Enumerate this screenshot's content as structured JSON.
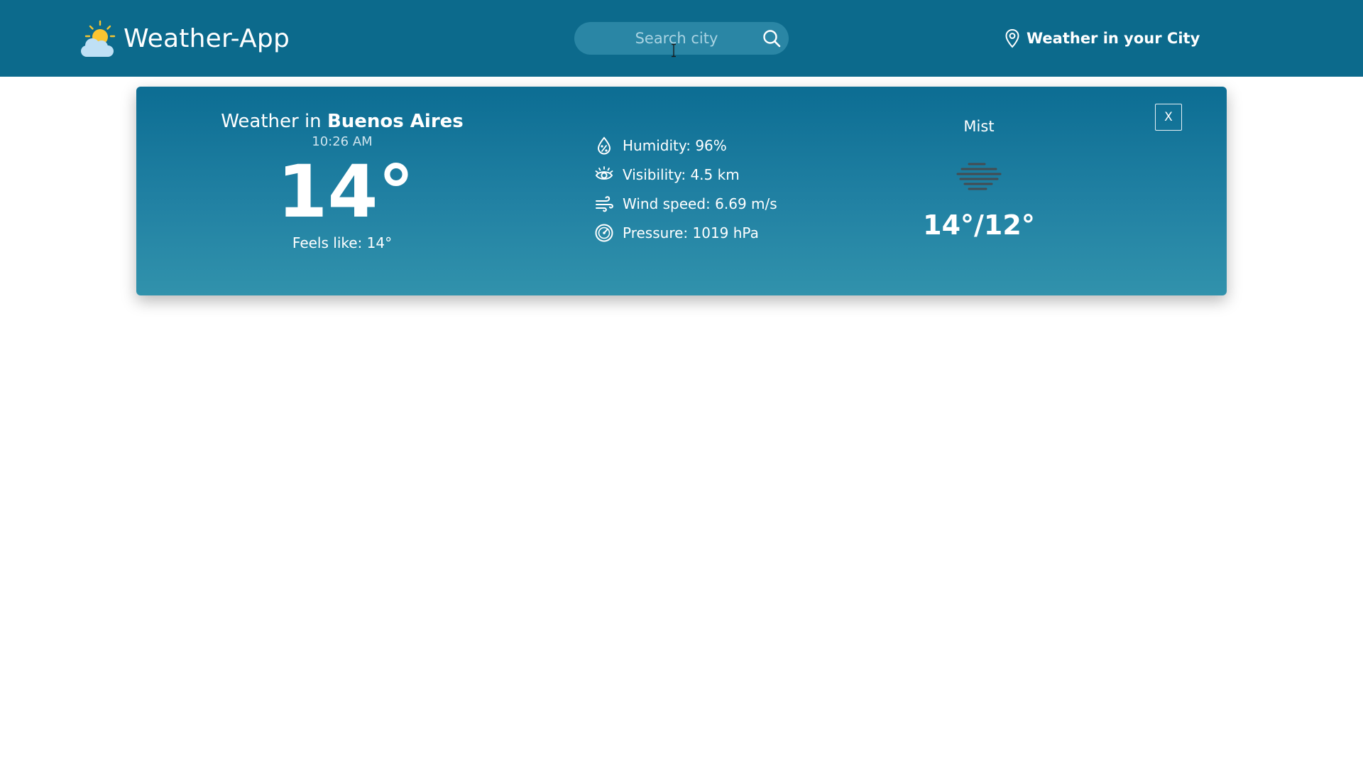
{
  "navbar": {
    "brand": "Weather-App",
    "brand_logo": "partly-sunny-icon",
    "search": {
      "placeholder": "Search city",
      "value": "",
      "icon": "search-icon"
    },
    "location_link": {
      "label": "Weather in your City",
      "icon": "map-pin-icon"
    }
  },
  "weather_card": {
    "heading_prefix": "Weather in",
    "city": "Buenos Aires",
    "local_time": "10:26 AM",
    "temperature": "14°",
    "feels_like": "Feels like: 14°",
    "details": [
      {
        "icon": "humidity-icon",
        "text": "Humidity: 96%"
      },
      {
        "icon": "visibility-eye-icon",
        "text": "Visibility: 4.5 km"
      },
      {
        "icon": "wind-icon",
        "text": "Wind speed: 6.69 m/s"
      },
      {
        "icon": "pressure-gauge-icon",
        "text": "Pressure: 1019 hPa"
      }
    ],
    "condition": "Mist",
    "condition_icon": "mist-icon",
    "min_max": "14°/12°",
    "close_label": "X"
  },
  "colors": {
    "navbar": "#0c6a8c",
    "card_top": "#0c6d93",
    "card_bottom": "#3192ac",
    "search_bg": "#2a86a5"
  }
}
